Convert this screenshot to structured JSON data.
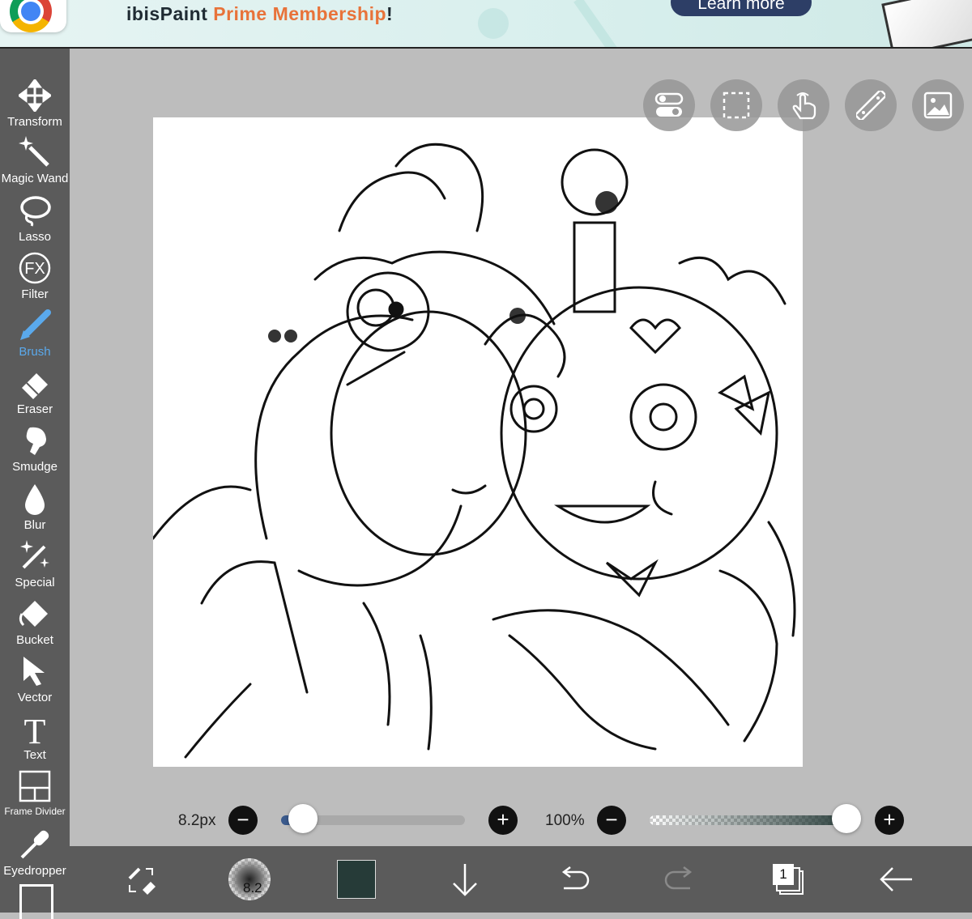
{
  "banner": {
    "title_main": "ibisPaint ",
    "title_accent": "Prime Membership",
    "title_end": "!",
    "learn_more": "Learn more"
  },
  "toolbar": {
    "tools": [
      {
        "label": "Transform",
        "icon": "move-arrows-icon"
      },
      {
        "label": "Magic Wand",
        "icon": "magic-wand-icon"
      },
      {
        "label": "Lasso",
        "icon": "lasso-icon"
      },
      {
        "label": "Filter",
        "icon": "fx-icon",
        "icon_text": "FX"
      },
      {
        "label": "Brush",
        "icon": "brush-icon",
        "selected": true
      },
      {
        "label": "Eraser",
        "icon": "eraser-icon"
      },
      {
        "label": "Smudge",
        "icon": "smudge-icon"
      },
      {
        "label": "Blur",
        "icon": "blur-drop-icon"
      },
      {
        "label": "Special",
        "icon": "sparkle-icon"
      },
      {
        "label": "Bucket",
        "icon": "bucket-icon"
      },
      {
        "label": "Vector",
        "icon": "vector-cursor-icon"
      },
      {
        "label": "Text",
        "icon": "text-icon",
        "icon_text": "T"
      },
      {
        "label": "Frame Divider",
        "icon": "frame-divider-icon"
      },
      {
        "label": "Eyedropper",
        "icon": "eyedropper-icon"
      }
    ],
    "accent_color": "#5aa9ec"
  },
  "canvas": {
    "top_buttons": [
      "toggle-icon",
      "selection-rect-icon",
      "touch-hand-icon",
      "ruler-icon",
      "reference-image-icon"
    ]
  },
  "sliders": {
    "brush_size_label": "8.2px",
    "brush_size_fraction": 0.12,
    "opacity_label": "100%",
    "opacity_fraction": 1.0,
    "minus_glyph": "−",
    "plus_glyph": "+"
  },
  "bottombar": {
    "brush_preview_size": "8.2",
    "current_color": "#263b38",
    "layer_count": "1"
  }
}
